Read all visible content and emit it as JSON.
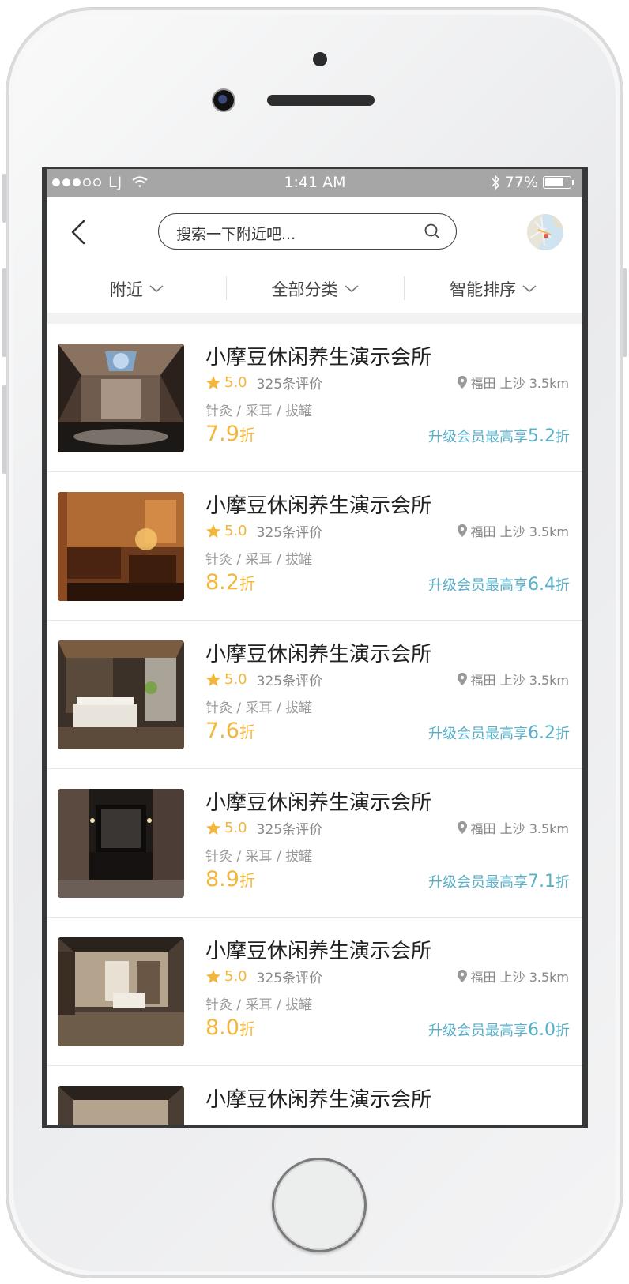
{
  "status_bar": {
    "carrier": "LJ",
    "time": "1:41 AM",
    "battery": "77%",
    "battery_level": 0.77
  },
  "header": {
    "search_placeholder": "搜索一下附近吧..."
  },
  "filters": [
    {
      "label": "附近"
    },
    {
      "label": "全部分类"
    },
    {
      "label": "智能排序"
    }
  ],
  "colors": {
    "accent": "#f2b63b",
    "promo": "#5ab0c8"
  },
  "listings": [
    {
      "title": "小摩豆休闲养生演示会所",
      "score": "5.0",
      "reviews": "325条评价",
      "location": "福田 上沙 3.5km",
      "tags": "针灸 /  采耳 / 拔罐",
      "discount": "7.9",
      "discount_unit": "折",
      "promo_prefix": "升级会员最高享",
      "promo_value": "5.2",
      "promo_unit": "折"
    },
    {
      "title": "小摩豆休闲养生演示会所",
      "score": "5.0",
      "reviews": "325条评价",
      "location": "福田 上沙 3.5km",
      "tags": "针灸 /  采耳 / 拔罐",
      "discount": "8.2",
      "discount_unit": "折",
      "promo_prefix": "升级会员最高享",
      "promo_value": "6.4",
      "promo_unit": "折"
    },
    {
      "title": "小摩豆休闲养生演示会所",
      "score": "5.0",
      "reviews": "325条评价",
      "location": "福田 上沙 3.5km",
      "tags": "针灸 /  采耳 / 拔罐",
      "discount": "7.6",
      "discount_unit": "折",
      "promo_prefix": "升级会员最高享",
      "promo_value": "6.2",
      "promo_unit": "折"
    },
    {
      "title": "小摩豆休闲养生演示会所",
      "score": "5.0",
      "reviews": "325条评价",
      "location": "福田 上沙 3.5km",
      "tags": "针灸 /  采耳 / 拔罐",
      "discount": "8.9",
      "discount_unit": "折",
      "promo_prefix": "升级会员最高享",
      "promo_value": "7.1",
      "promo_unit": "折"
    },
    {
      "title": "小摩豆休闲养生演示会所",
      "score": "5.0",
      "reviews": "325条评价",
      "location": "福田 上沙 3.5km",
      "tags": "针灸 /  采耳 / 拔罐",
      "discount": "8.0",
      "discount_unit": "折",
      "promo_prefix": "升级会员最高享",
      "promo_value": "6.0",
      "promo_unit": "折"
    },
    {
      "title": "小摩豆休闲养生演示会所"
    }
  ]
}
